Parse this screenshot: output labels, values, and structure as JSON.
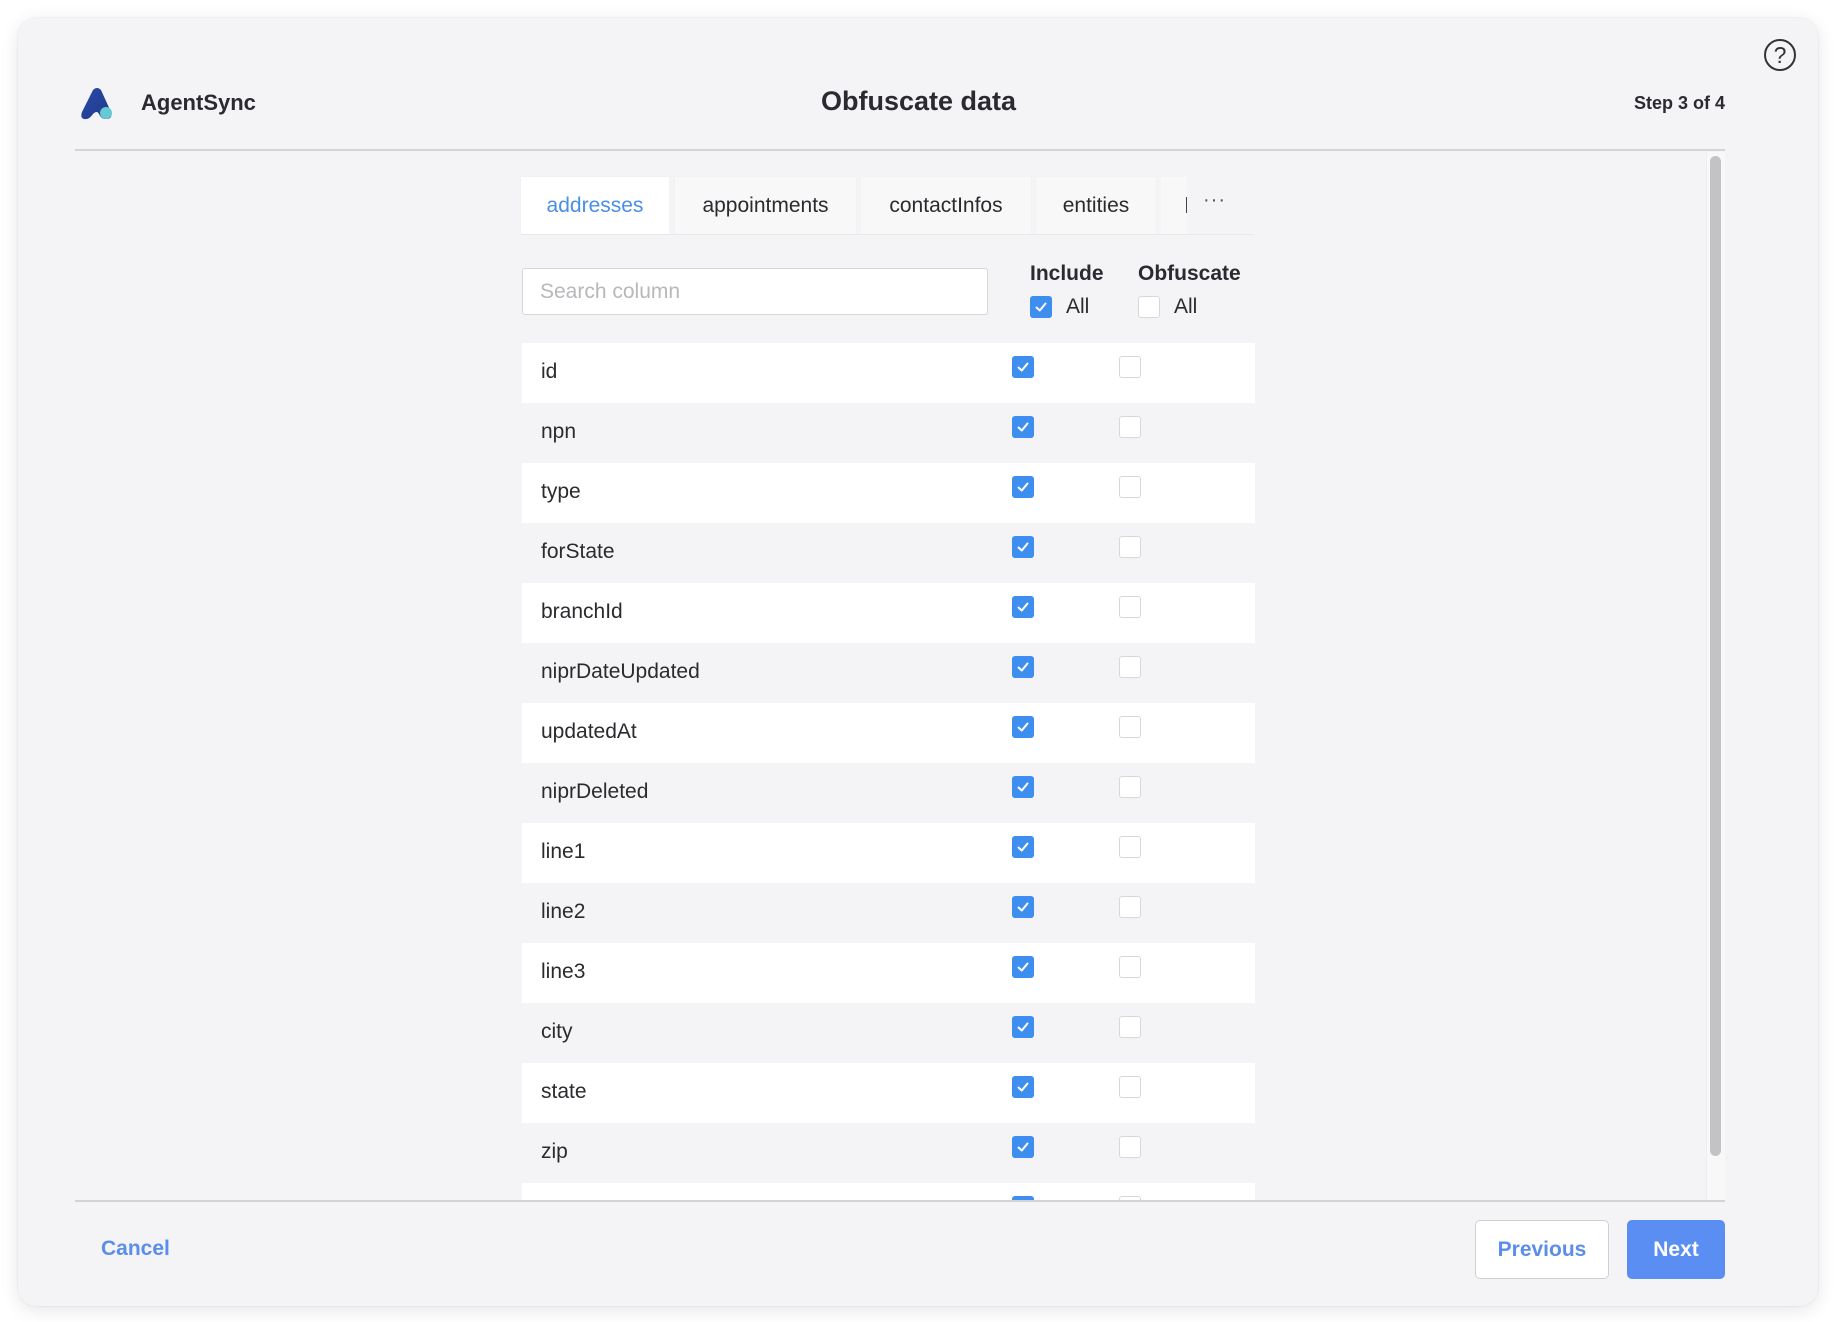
{
  "header": {
    "brand_name": "AgentSync",
    "title": "Obfuscate data",
    "step": "Step 3 of 4",
    "help_icon": "question-circle-icon",
    "help_glyph": "?"
  },
  "tabs": {
    "items": [
      {
        "label": "addresses",
        "active": true
      },
      {
        "label": "appointments",
        "active": false
      },
      {
        "label": "contactInfos",
        "active": false
      },
      {
        "label": "entities",
        "active": false
      }
    ],
    "more_label": "···"
  },
  "search": {
    "placeholder": "Search column",
    "value": ""
  },
  "columns": {
    "include_label": "Include",
    "obfuscate_label": "Obfuscate",
    "include_all_label": "All",
    "include_all_checked": true,
    "obfuscate_all_label": "All",
    "obfuscate_all_checked": false
  },
  "rows": [
    {
      "name": "id",
      "include": true,
      "obfuscate": false
    },
    {
      "name": "npn",
      "include": true,
      "obfuscate": false
    },
    {
      "name": "type",
      "include": true,
      "obfuscate": false
    },
    {
      "name": "forState",
      "include": true,
      "obfuscate": false
    },
    {
      "name": "branchId",
      "include": true,
      "obfuscate": false
    },
    {
      "name": "niprDateUpdated",
      "include": true,
      "obfuscate": false
    },
    {
      "name": "updatedAt",
      "include": true,
      "obfuscate": false
    },
    {
      "name": "niprDeleted",
      "include": true,
      "obfuscate": false
    },
    {
      "name": "line1",
      "include": true,
      "obfuscate": false
    },
    {
      "name": "line2",
      "include": true,
      "obfuscate": false
    },
    {
      "name": "line3",
      "include": true,
      "obfuscate": false
    },
    {
      "name": "city",
      "include": true,
      "obfuscate": false
    },
    {
      "name": "state",
      "include": true,
      "obfuscate": false
    },
    {
      "name": "zip",
      "include": true,
      "obfuscate": false
    },
    {
      "name": "",
      "include": true,
      "obfuscate": false
    }
  ],
  "footer": {
    "cancel_label": "Cancel",
    "previous_label": "Previous",
    "next_label": "Next"
  },
  "colors": {
    "accent": "#3e8ef0",
    "link": "#5b8ee8",
    "primary_button": "#5b8ef3",
    "active_tab_text": "#4a8ee6",
    "background": "#f4f4f6"
  }
}
